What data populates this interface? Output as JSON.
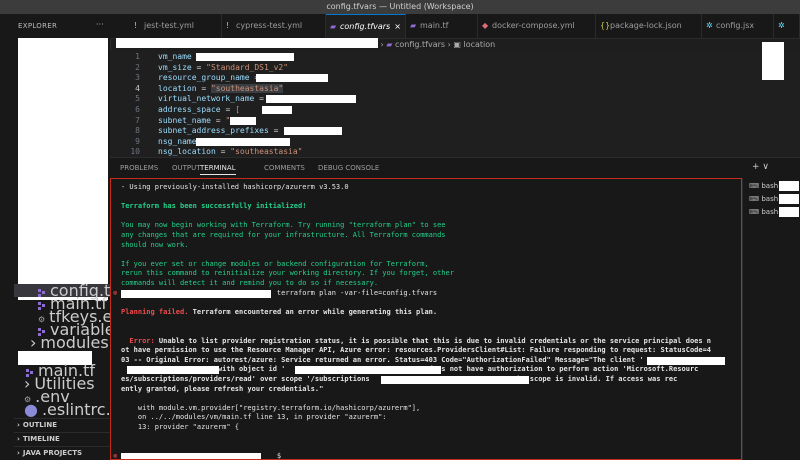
{
  "window": {
    "title": "config.tfvars — Untitled (Workspace)"
  },
  "sidebar": {
    "title": "EXPLORER",
    "files": [
      {
        "label": "config.tfvars",
        "icon": "terraform-icon"
      },
      {
        "label": "main.tf",
        "icon": "terraform-icon"
      },
      {
        "label": "tfkeys.env",
        "icon": "gear-icon"
      },
      {
        "label": "variables.tf",
        "icon": "terraform-icon"
      }
    ],
    "modules_label": "modules",
    "main_tf_label": "main.tf",
    "utilities_label": "Utilities",
    "env_label": ".env",
    "eslintrc_label": ".eslintrc.json",
    "sections": [
      "OUTLINE",
      "TIMELINE",
      "JAVA PROJECTS"
    ]
  },
  "tabs": [
    {
      "label": "jest-test.yml",
      "icon": "!"
    },
    {
      "label": "cypress-test.yml",
      "icon": "!"
    },
    {
      "label": "config.tfvars",
      "icon": "tf"
    },
    {
      "label": "main.tf",
      "icon": "tf"
    },
    {
      "label": "docker-compose.yml",
      "icon": "docker"
    },
    {
      "label": "package-lock.json",
      "icon": "{}"
    },
    {
      "label": "config.jsx",
      "icon": "react"
    }
  ],
  "breadcrumb": {
    "file": "config.tfvars",
    "symbol": "location"
  },
  "editor": {
    "lines": [
      {
        "n": "1",
        "key": "vm_name",
        "op": " = ",
        "val": ""
      },
      {
        "n": "2",
        "key": "vm_size",
        "op": " = ",
        "val": "\"Standard_DS1_v2\""
      },
      {
        "n": "3",
        "key": "resource_group_name",
        "op": " = ",
        "val": ""
      },
      {
        "n": "4",
        "key": "location",
        "op": " = ",
        "val": "\"southeastasia\""
      },
      {
        "n": "5",
        "key": "virtual_network_name",
        "op": " = ",
        "val": "\""
      },
      {
        "n": "6",
        "key": "address_space",
        "op": " = ",
        "val": "["
      },
      {
        "n": "7",
        "key": "subnet_name",
        "op": " = ",
        "val": "\""
      },
      {
        "n": "8",
        "key": "subnet_address_prefixes",
        "op": " = ",
        "val": "[ \""
      },
      {
        "n": "9",
        "key": "nsg_name",
        "op": " = ",
        "val": "\""
      },
      {
        "n": "10",
        "key": "nsg_location",
        "op": " = ",
        "val": "\"southeastasia\""
      }
    ],
    "current_line": "4"
  },
  "panel": {
    "tabs": [
      "PROBLEMS",
      "OUTPUT",
      "TERMINAL",
      "COMMENTS",
      "DEBUG CONSOLE"
    ],
    "active_tab": "TERMINAL",
    "actions": "+ ∨"
  },
  "terminal": {
    "lines": [
      {
        "text": "- Using previously-installed hashicorp/azurerm v3.53.0",
        "style": "white"
      },
      {
        "text": "",
        "style": "white"
      },
      {
        "text": "Terraform has been successfully initialized!",
        "style": "greenb"
      },
      {
        "text": "",
        "style": "white"
      },
      {
        "text": "You may now begin working with Terraform. Try running \"terraform plan\" to see",
        "style": "green"
      },
      {
        "text": "any changes that are required for your infrastructure. All Terraform commands",
        "style": "green"
      },
      {
        "text": "should now work.",
        "style": "green"
      },
      {
        "text": "",
        "style": "white"
      },
      {
        "text": "If you ever set or change modules or backend configuration for Terraform,",
        "style": "green"
      },
      {
        "text": "rerun this command to reinitialize your working directory. If you forget, other",
        "style": "green"
      },
      {
        "text": "commands will detect it and remind you to do so if necessary.",
        "style": "green"
      },
      {
        "text": "                                     terraform plan -var-file=config.tfvars",
        "style": "white"
      },
      {
        "text": "",
        "style": "white"
      },
      {
        "text": "Planning failed.",
        "style": "redb",
        "rest": " Terraform encountered an error while generating this plan.",
        "rest_style": "whiteb"
      },
      {
        "text": "",
        "style": "white"
      },
      {
        "text": "",
        "style": "white"
      },
      {
        "text": "  Error:",
        "style": "redb",
        "rest": " Unable to list provider registration status, it is possible that this is due to invalid credentials or the service principal does n",
        "rest_style": "whiteb"
      },
      {
        "text": "ot have permission to use the Resource Manager API, Azure error: resources.ProvidersClient#List: Failure responding to request: StatusCode=4",
        "style": "whiteb"
      },
      {
        "text": "03 -- Original Error: autorest/azure: Service returned an error. Status=403 Code=\"AuthorizationFailed\" Message=\"The client '",
        "style": "whiteb"
      },
      {
        "text": "                       with object id '                                  does not have authorization to perform action 'Microsoft.Resourc",
        "style": "whiteb"
      },
      {
        "text": "es/subscriptions/providers/read' over scope '/subscriptions                             ' or the scope is invalid. If access was rec",
        "style": "whiteb"
      },
      {
        "text": "ently granted, please refresh your credentials.\"",
        "style": "whiteb"
      },
      {
        "text": "",
        "style": "white"
      },
      {
        "text": "    with module.vm.provider[\"registry.terraform.io/hashicorp/azurerm\"],",
        "style": "white"
      },
      {
        "text": "    on ../../modules/vm/main.tf line 13, in provider \"azurerm\":",
        "style": "white"
      },
      {
        "text": "    13: provider \"azurerm\" {",
        "style": "white"
      },
      {
        "text": "",
        "style": "white"
      },
      {
        "text": "",
        "style": "white"
      },
      {
        "text": "                                     $",
        "style": "white"
      }
    ]
  },
  "terminal_list": {
    "items": [
      "bash",
      "bash",
      "bash"
    ]
  }
}
